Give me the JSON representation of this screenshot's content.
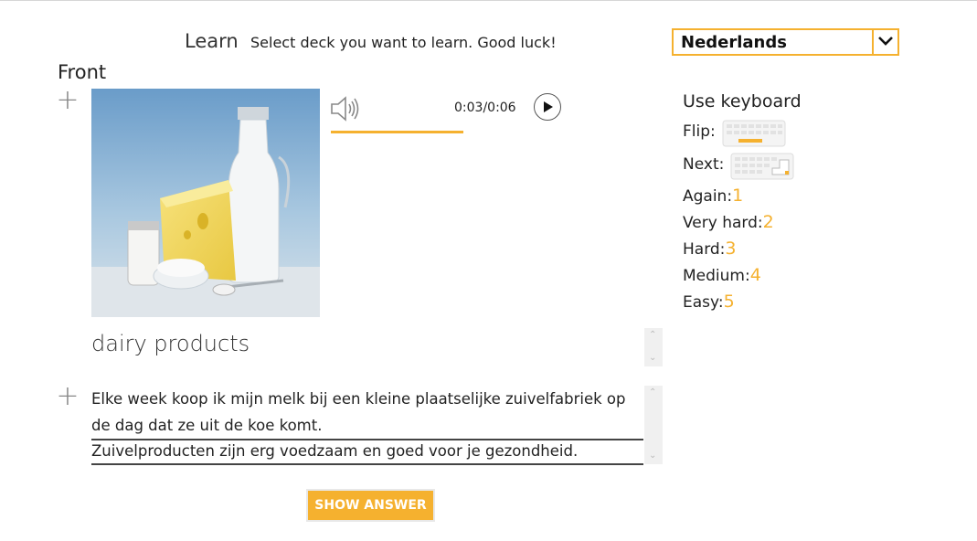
{
  "header": {
    "title": "Learn",
    "subtitle": "Select deck you want to learn. Good luck!"
  },
  "language_select": {
    "value": "Nederlands",
    "icon": "chevron-down-icon"
  },
  "card": {
    "side_label": "Front",
    "image_alt": "dairy products photo",
    "audio": {
      "time": "0:03/0:06",
      "progress": 0.5
    },
    "word": "dairy products",
    "sentence_1": "Elke week koop ik mijn melk bij een kleine plaatselijke zuivelfabriek op de dag dat ze uit de koe komt.",
    "sentence_2": "Zuivelproducten zijn erg voedzaam en goed voor je gezondheid."
  },
  "actions": {
    "show_answer": "SHOW ANSWER"
  },
  "keyboard": {
    "title": "Use keyboard",
    "flip_label": "Flip:",
    "next_label": "Next:",
    "again_label": "Again:",
    "again_key": "1",
    "very_hard_label": "Very hard:",
    "very_hard_key": "2",
    "hard_label": "Hard:",
    "hard_key": "3",
    "medium_label": "Medium:",
    "medium_key": "4",
    "easy_label": "Easy:",
    "easy_key": "5"
  },
  "colors": {
    "accent": "#f5b12f"
  }
}
